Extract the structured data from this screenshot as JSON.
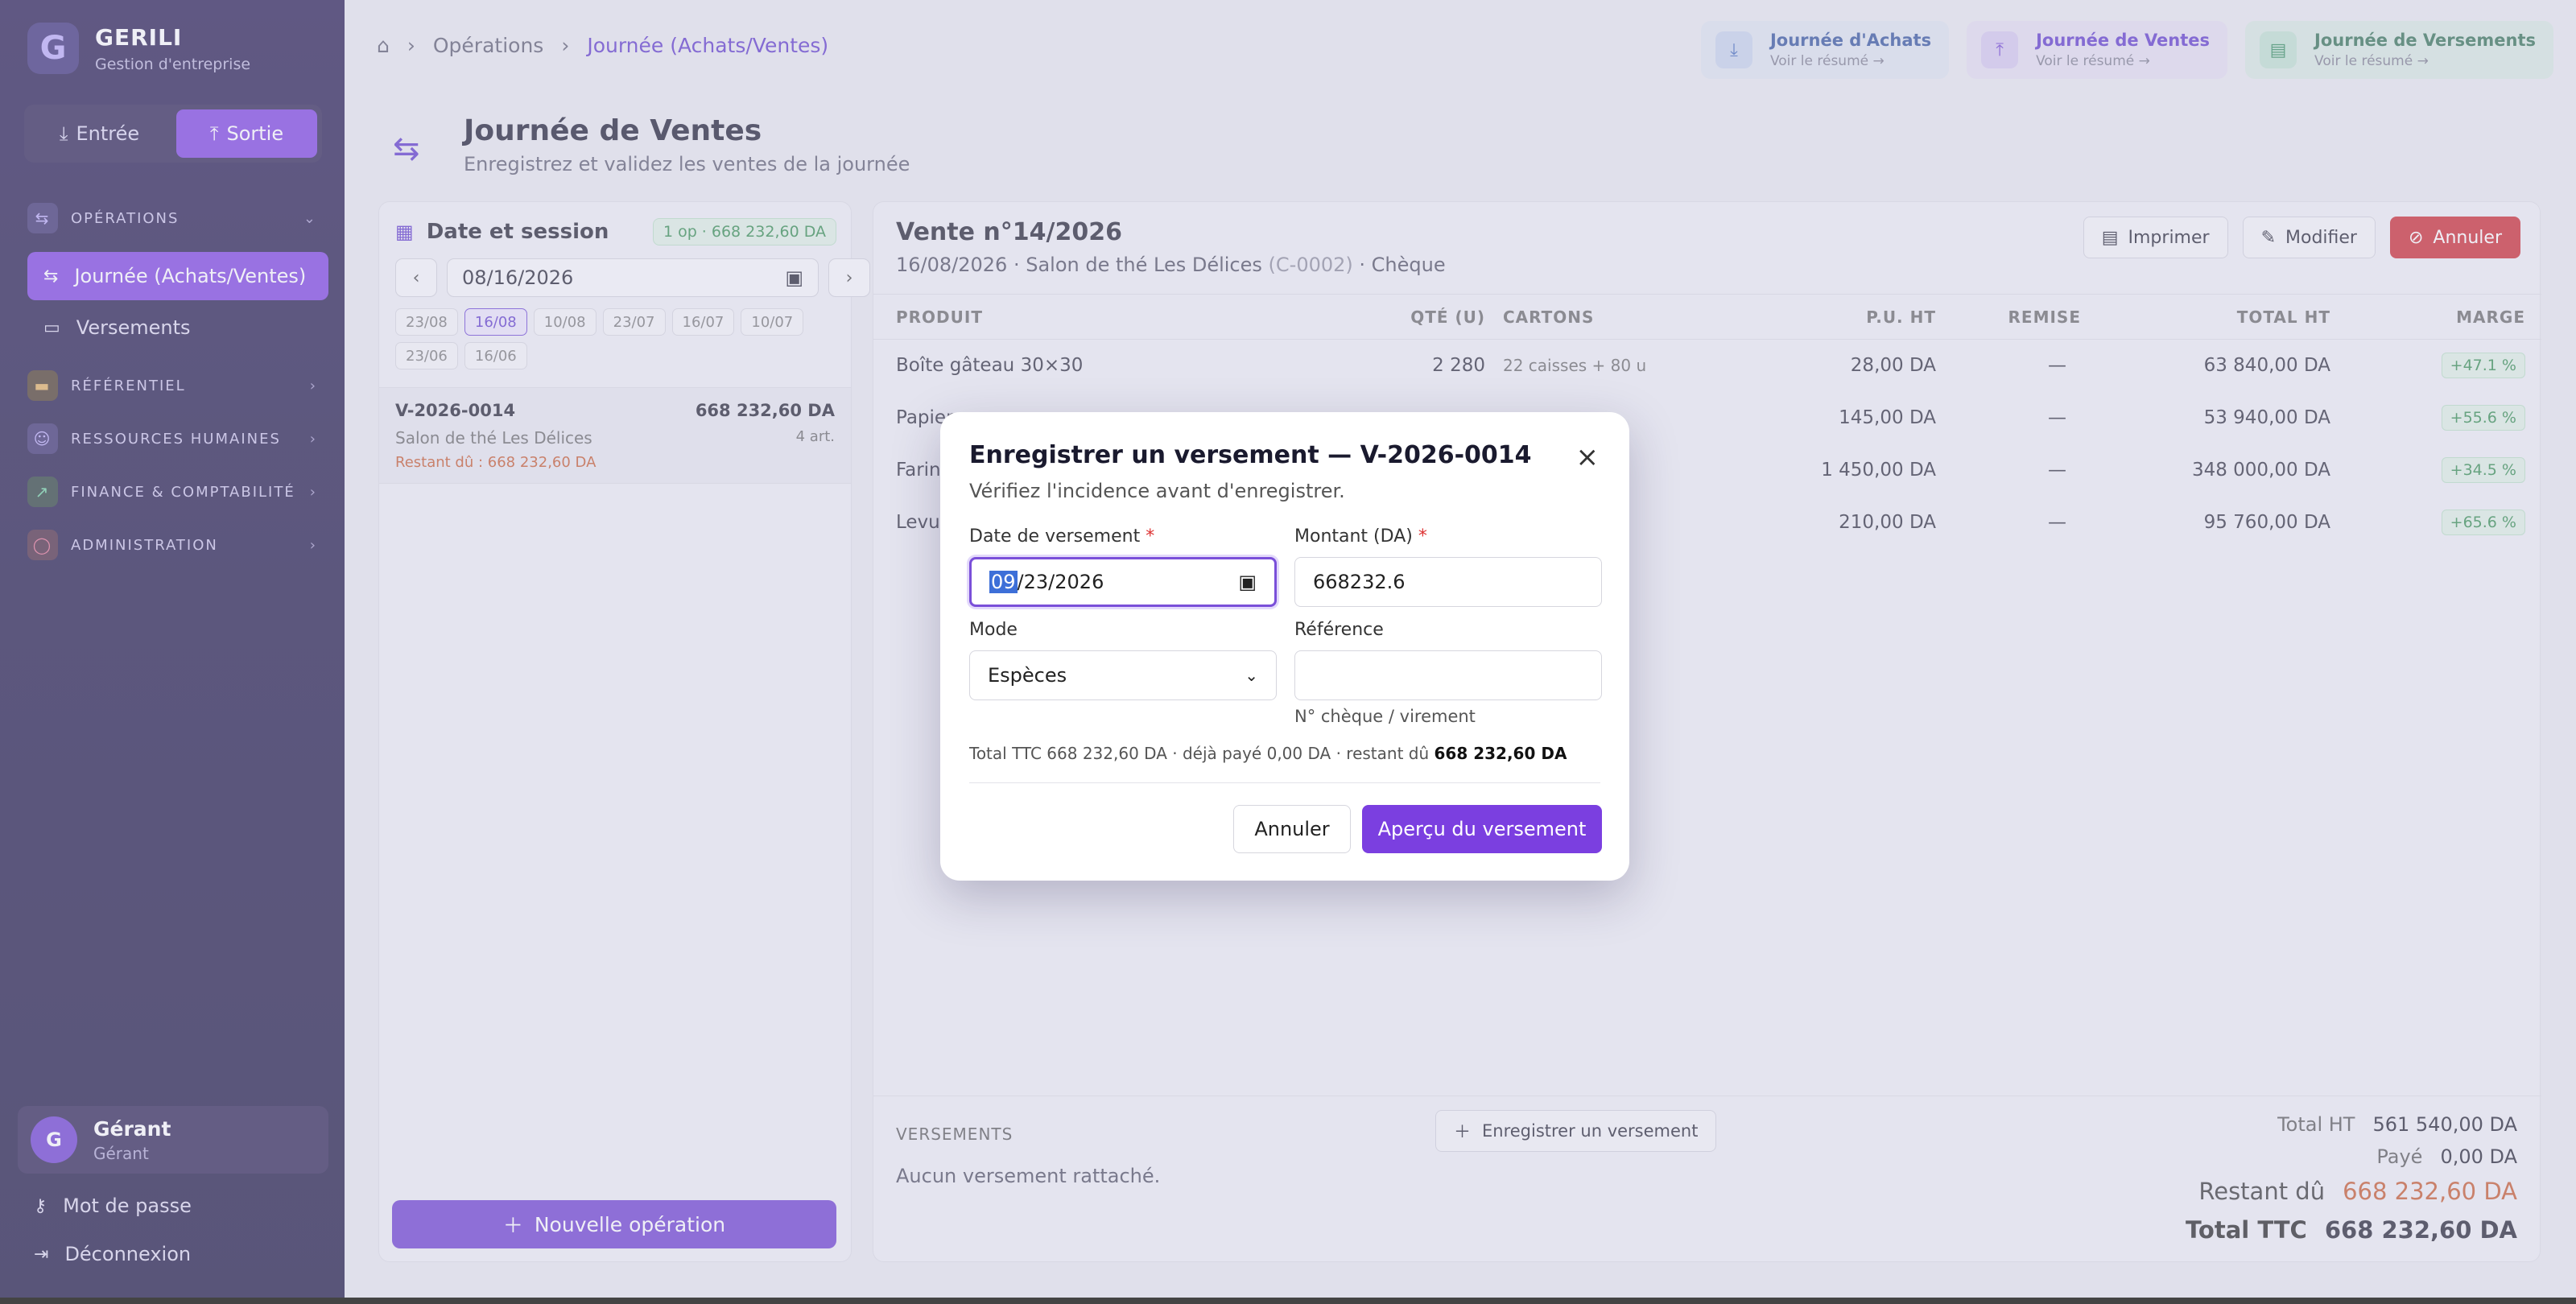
{
  "brand": {
    "name": "GERILI",
    "tagline": "Gestion d'entreprise"
  },
  "io": {
    "in": "Entrée",
    "out": "Sortie"
  },
  "sidebar": {
    "operations": "OPÉRATIONS",
    "items": [
      "Journée (Achats/Ventes)",
      "Versements"
    ],
    "referentiel": "RÉFÉRENTIEL",
    "rh": "RESSOURCES HUMAINES",
    "finance": "FINANCE & COMPTABILITÉ",
    "admin": "ADMINISTRATION"
  },
  "user": {
    "initial": "G",
    "name": "Gérant",
    "role": "Gérant"
  },
  "footer": {
    "password": "Mot de passe",
    "logout": "Déconnexion"
  },
  "breadcrumb": {
    "l1": "Opérations",
    "l2": "Journée (Achats/Ventes)"
  },
  "toplinks": [
    {
      "title": "Journée d'Achats",
      "sub": "Voir le résumé →"
    },
    {
      "title": "Journée de Ventes",
      "sub": "Voir le résumé →"
    },
    {
      "title": "Journée de Versements",
      "sub": "Voir le résumé →"
    }
  ],
  "page": {
    "title": "Journée de Ventes",
    "subtitle": "Enregistrez et validez les ventes de la journée"
  },
  "left": {
    "title": "Date et session",
    "badge": "1 op · 668 232,60 DA",
    "date": "08/16/2026",
    "chips": [
      "23/08",
      "16/08",
      "10/08",
      "23/07",
      "16/07",
      "10/07",
      "23/06",
      "16/06"
    ],
    "op": {
      "id": "V-2026-0014",
      "amount": "668 232,60 DA",
      "client": "Salon de thé Les Délices",
      "count": "4 art.",
      "due": "Restant dû : 668 232,60 DA"
    },
    "new": "Nouvelle opération"
  },
  "sale": {
    "title": "Vente n°14/2026",
    "meta1": "16/08/2026 · Salon de thé Les Délices",
    "code": "(C-0002)",
    "meta2": "· Chèque",
    "print": "Imprimer",
    "edit": "Modifier",
    "cancel": "Annuler"
  },
  "table": {
    "headers": [
      "PRODUIT",
      "QTÉ (U)",
      "CARTONS",
      "P.U. HT",
      "REMISE",
      "TOTAL HT",
      "MARGE"
    ],
    "rows": [
      [
        "Boîte gâteau 30×30",
        "2 280",
        "22 caisses + 80 u",
        "28,00 DA",
        "—",
        "63 840,00 DA",
        "+47.1 %"
      ],
      [
        "Papier",
        "",
        "",
        "145,00 DA",
        "—",
        "53 940,00 DA",
        "+55.6 %"
      ],
      [
        "Farin",
        "",
        "",
        "1 450,00 DA",
        "—",
        "348 000,00 DA",
        "+34.5 %"
      ],
      [
        "Levur",
        "",
        "",
        "210,00 DA",
        "—",
        "95 760,00 DA",
        "+65.6 %"
      ]
    ]
  },
  "versements": {
    "label": "VERSEMENTS",
    "button": "Enregistrer un versement",
    "none": "Aucun versement rattaché."
  },
  "totals": {
    "ht_k": "Total HT",
    "ht_v": "561 540,00 DA",
    "paid_k": "Payé",
    "paid_v": "0,00 DA",
    "due_k": "Restant dû",
    "due_v": "668 232,60 DA",
    "ttc_k": "Total TTC",
    "ttc_v": "668 232,60 DA"
  },
  "modal": {
    "title": "Enregistrer un versement — V-2026-0014",
    "subtitle": "Vérifiez l'incidence avant d'enregistrer.",
    "date_label": "Date de versement",
    "date_sel": "09",
    "date_rest": "/23/2026",
    "amount_label": "Montant (DA)",
    "amount": "668232.6",
    "mode_label": "Mode",
    "mode": "Espèces",
    "ref_label": "Référence",
    "ref_hint": "N° chèque / virement",
    "summary_pre": "Total TTC 668 232,60 DA · déjà payé 0,00 DA · restant dû",
    "summary_due": "668 232,60 DA",
    "cancel": "Annuler",
    "ok": "Aperçu du versement"
  },
  "colors": {
    "accent": "#7b3fe0",
    "danger": "#c9262d",
    "success": "#2e8a4a"
  }
}
